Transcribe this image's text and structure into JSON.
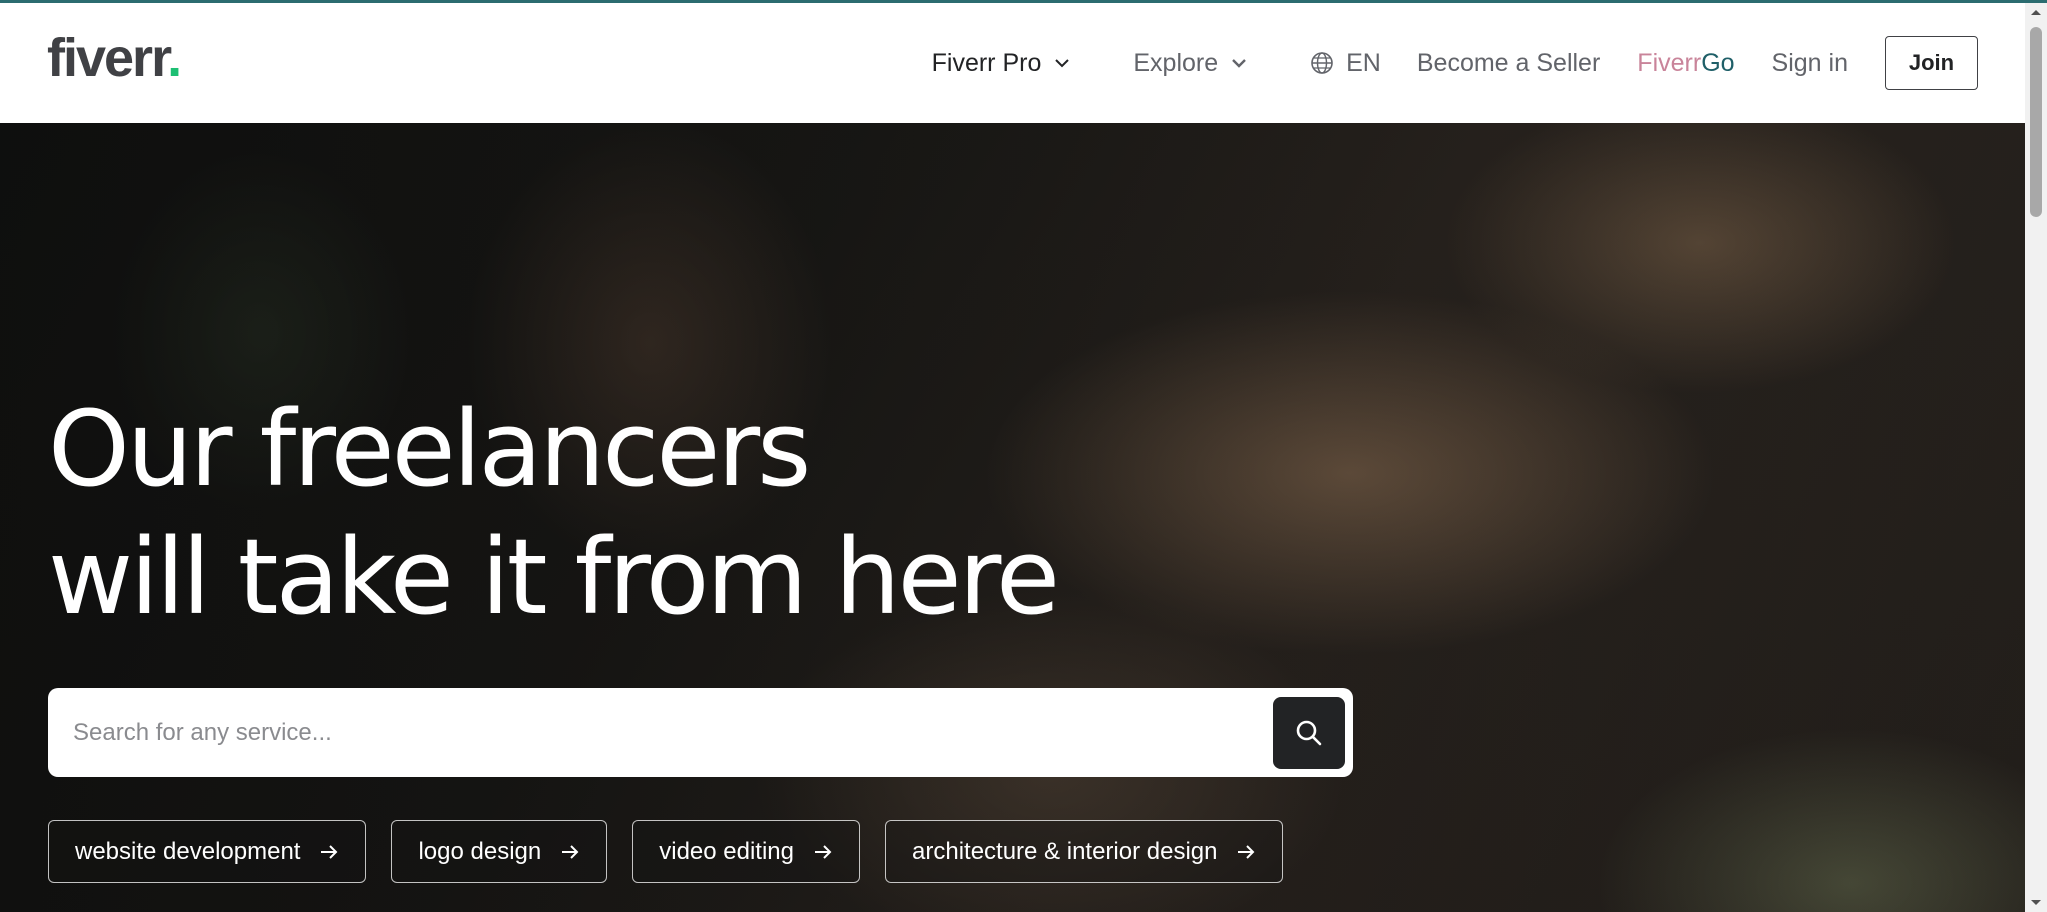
{
  "header": {
    "logo_text": "fiverr",
    "logo_dot": ".",
    "nav": {
      "fiverr_pro": "Fiverr Pro",
      "explore": "Explore",
      "language": "EN",
      "become_seller": "Become a Seller",
      "fiverr_go_a": "Fiverr",
      "fiverr_go_b": " Go",
      "sign_in": "Sign in",
      "join": "Join"
    }
  },
  "hero": {
    "headline_line1": "Our freelancers",
    "headline_line2": "will take it from here",
    "search": {
      "placeholder": "Search for any service...",
      "value": ""
    },
    "chips": [
      {
        "label": "website development"
      },
      {
        "label": "logo design"
      },
      {
        "label": "video editing"
      },
      {
        "label": "architecture & interior design"
      }
    ]
  },
  "colors": {
    "brand_green": "#1dbf73",
    "text_dark": "#222325",
    "text_gray": "#62646a",
    "go_pink": "#c9849a",
    "go_teal": "#1f5f68"
  },
  "icons": {
    "chevron": "chevron-down-icon",
    "globe": "globe-icon",
    "search": "search-icon",
    "arrow": "arrow-right-icon"
  }
}
